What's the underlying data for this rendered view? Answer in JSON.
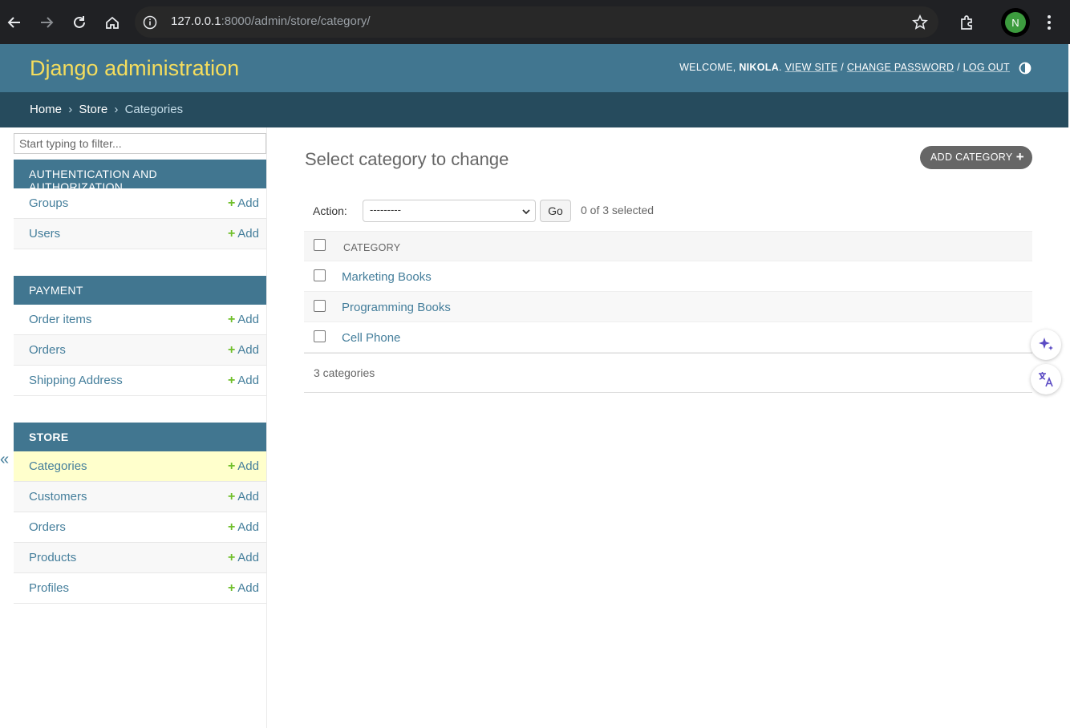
{
  "browser": {
    "url_host": "127.0.0.1",
    "url_rest": ":8000/admin/store/category/",
    "profile_initial": "N"
  },
  "header": {
    "site_name": "Django administration",
    "welcome": "WELCOME,",
    "username": "NIKOLA",
    "view_site": "VIEW SITE",
    "change_password": "CHANGE PASSWORD",
    "log_out": "LOG OUT",
    "sep": "/"
  },
  "breadcrumbs": {
    "home": "Home",
    "store": "Store",
    "current": "Categories",
    "sep": "›"
  },
  "sidebar": {
    "filter_placeholder": "Start typing to filter...",
    "toggle": "«",
    "add_label": "Add",
    "modules": [
      {
        "caption": "AUTHENTICATION AND AUTHORIZATION",
        "items": [
          "Groups",
          "Users"
        ]
      },
      {
        "caption": "PAYMENT",
        "items": [
          "Order items",
          "Orders",
          "Shipping Address"
        ]
      },
      {
        "caption": "STORE",
        "items": [
          "Categories",
          "Customers",
          "Orders",
          "Products",
          "Profiles"
        ]
      }
    ]
  },
  "main": {
    "title": "Select category to change",
    "add_button": "ADD CATEGORY",
    "action_label": "Action:",
    "action_selected": "---------",
    "go_label": "Go",
    "selected_count": "0 of 3 selected",
    "column_header": "CATEGORY",
    "rows": [
      "Marketing Books",
      "Programming Books",
      "Cell Phone"
    ],
    "result_count": "3 categories"
  },
  "colors": {
    "header_bg": "#417690",
    "breadcrumb_bg": "#264b5d",
    "site_name": "#f5dd5d",
    "link": "#447e9b",
    "add_plus": "#70bf2b",
    "current_row": "#ffffcc"
  }
}
